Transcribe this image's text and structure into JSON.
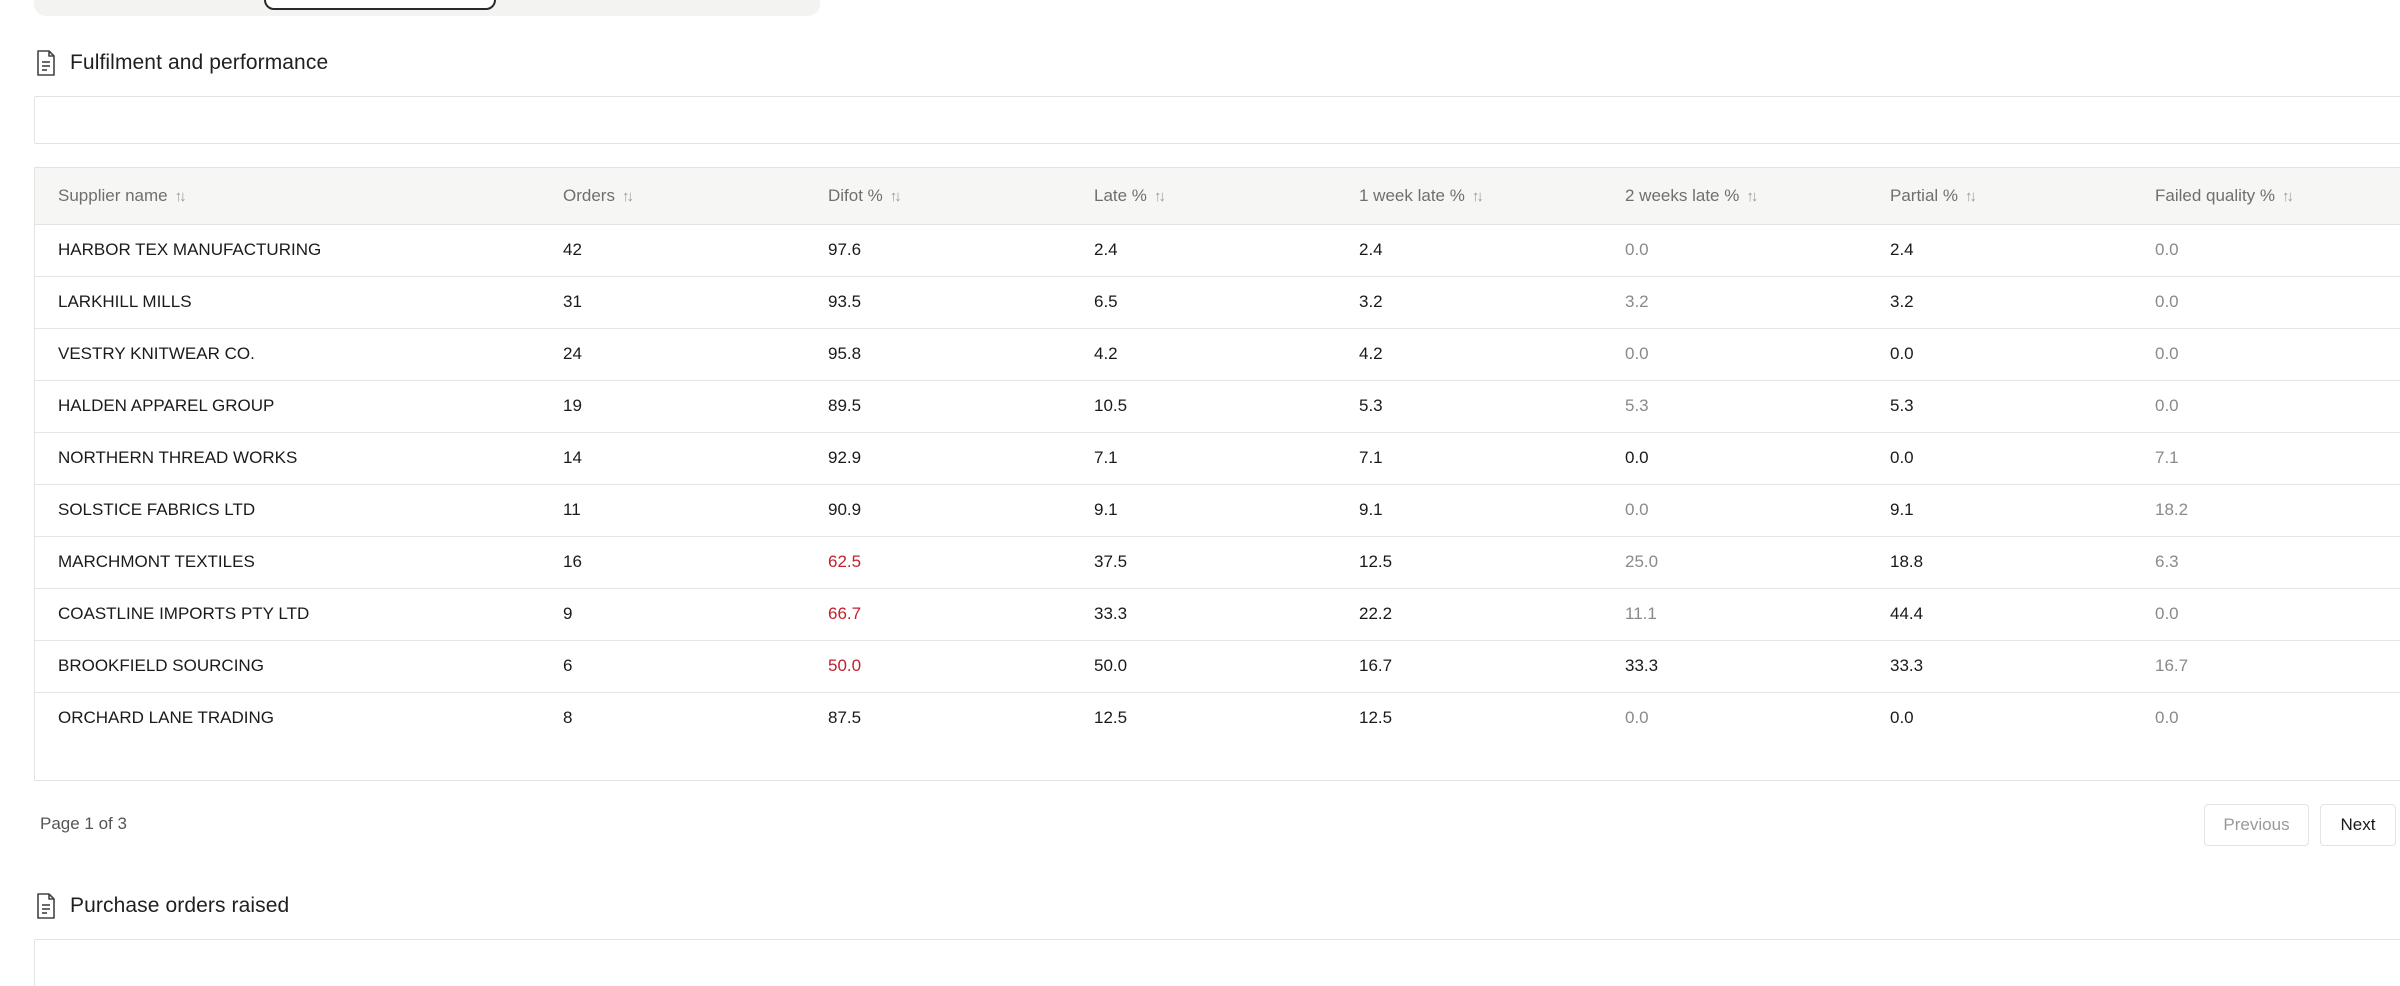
{
  "sections": {
    "fulfilment_title": "Fulfilment and performance",
    "purchase_orders_title": "Purchase orders raised"
  },
  "table": {
    "headers": [
      "Supplier name",
      "Orders",
      "Difot %",
      "Late %",
      "1 week late %",
      "2 weeks late %",
      "Partial %",
      "Failed quality %"
    ],
    "sort_glyph": "↑↓",
    "rows": [
      [
        "HARBOR TEX MANUFACTURING",
        "42",
        "97.6",
        "2.4",
        "2.4",
        "0.0",
        "2.4",
        "0.0"
      ],
      [
        "LARKHILL MILLS",
        "31",
        "93.5",
        "6.5",
        "3.2",
        "3.2",
        "3.2",
        "0.0"
      ],
      [
        "VESTRY KNITWEAR CO.",
        "24",
        "95.8",
        "4.2",
        "4.2",
        "0.0",
        "0.0",
        "0.0"
      ],
      [
        "HALDEN APPAREL GROUP",
        "19",
        "89.5",
        "10.5",
        "5.3",
        "5.3",
        "5.3",
        "0.0"
      ],
      [
        "NORTHERN THREAD WORKS",
        "14",
        "92.9",
        "7.1",
        "7.1",
        "0.0",
        "0.0",
        "7.1"
      ],
      [
        "SOLSTICE FABRICS LTD",
        "11",
        "90.9",
        "9.1",
        "9.1",
        "0.0",
        "9.1",
        "18.2"
      ],
      [
        "MARCHMONT TEXTILES",
        "16",
        "62.5",
        "37.5",
        "12.5",
        "25.0",
        "18.8",
        "6.3"
      ],
      [
        "COASTLINE IMPORTS PTY LTD",
        "9",
        "66.7",
        "33.3",
        "22.2",
        "11.1",
        "44.4",
        "0.0"
      ],
      [
        "BROOKFIELD SOURCING",
        "6",
        "50.0",
        "50.0",
        "16.7",
        "33.3",
        "33.3",
        "16.7"
      ],
      [
        "ORCHARD LANE TRADING",
        "8",
        "87.5",
        "12.5",
        "12.5",
        "0.0",
        "0.0",
        "0.0"
      ]
    ],
    "cell_styles": [
      [
        "",
        "",
        "",
        "",
        "",
        "muted",
        "",
        "muted"
      ],
      [
        "",
        "",
        "",
        "",
        "",
        "muted",
        "",
        "muted"
      ],
      [
        "",
        "",
        "",
        "",
        "",
        "muted",
        "",
        "muted"
      ],
      [
        "",
        "",
        "",
        "",
        "",
        "muted",
        "",
        "muted"
      ],
      [
        "",
        "",
        "",
        "",
        "",
        "",
        "",
        "muted"
      ],
      [
        "",
        "",
        "",
        "",
        "",
        "muted",
        "",
        "muted"
      ],
      [
        "",
        "",
        "alert",
        "",
        "",
        "muted",
        "",
        "muted"
      ],
      [
        "",
        "",
        "alert",
        "",
        "",
        "muted",
        "",
        "muted"
      ],
      [
        "",
        "",
        "alert",
        "",
        "",
        "",
        "",
        "muted"
      ],
      [
        "",
        "",
        "",
        "",
        "",
        "muted",
        "",
        "muted"
      ]
    ]
  },
  "pagination": {
    "info": "Page 1 of 3",
    "previous_label": "Previous",
    "next_label": "Next"
  },
  "colors": {
    "alert": "#c0212e",
    "muted": "#8a8a8a"
  },
  "icons": {
    "section": "document-icon",
    "sort": "sort-icon"
  }
}
